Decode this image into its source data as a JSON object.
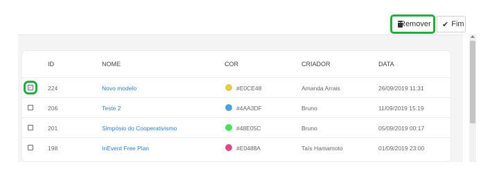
{
  "toolbar": {
    "remove_label": "Remover",
    "done_label": "Fim",
    "highlight_color": "#1fae3b"
  },
  "table": {
    "columns": [
      "ID",
      "NOME",
      "COR",
      "CRIADOR",
      "DATA"
    ],
    "rows": [
      {
        "checked": true,
        "id": "224",
        "name": "Novo modelo",
        "color_hex": "#E0CE48",
        "color": "#E0CE48",
        "creator": "Amanda Arrais",
        "date": "26/09/2019 11:31"
      },
      {
        "checked": false,
        "id": "206",
        "name": "Teste 2",
        "color_hex": "#4AA3DF",
        "color": "#4AA3DF",
        "creator": "Bruno",
        "date": "11/09/2019 15:19"
      },
      {
        "checked": false,
        "id": "201",
        "name": "Simpósio do Cooperativismo",
        "color_hex": "#48E05C",
        "color": "#48E05C",
        "creator": "Bruno",
        "date": "05/09/2019 00:17"
      },
      {
        "checked": false,
        "id": "198",
        "name": "InEvent Free Plan",
        "color_hex": "#E0488A",
        "color": "#E0488A",
        "creator": "Taís Hamamoto",
        "date": "01/09/2019 23:00"
      }
    ]
  }
}
